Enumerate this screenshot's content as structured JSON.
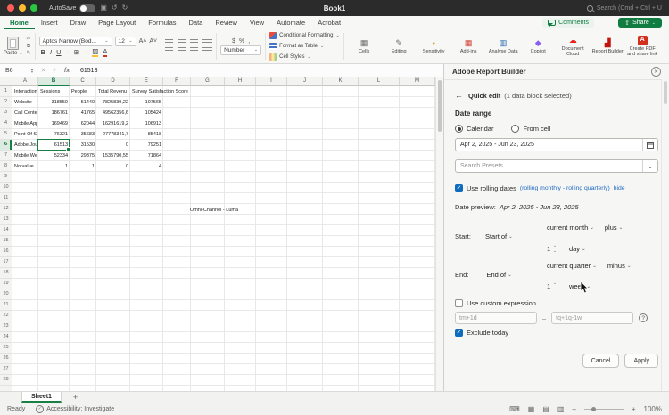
{
  "titlebar": {
    "autosave": "AutoSave",
    "title": "Book1",
    "search": "Search (Cmd + Ctrl + U"
  },
  "ribbon": {
    "tabs": [
      {
        "label": "Home",
        "active": true
      },
      {
        "label": "Insert"
      },
      {
        "label": "Draw"
      },
      {
        "label": "Page Layout"
      },
      {
        "label": "Formulas"
      },
      {
        "label": "Data"
      },
      {
        "label": "Review"
      },
      {
        "label": "View"
      },
      {
        "label": "Automate"
      },
      {
        "label": "Acrobat"
      }
    ],
    "comments": "Comments",
    "share": "Share",
    "paste": "Paste",
    "font_name": "Aptos Narrow (Bod...",
    "font_size": "12",
    "number_label": "Number",
    "styles": [
      "Conditional Formatting",
      "Format as Table",
      "Cell Styles"
    ],
    "big_buttons": [
      {
        "label": "Cells",
        "icon": "cells-icon"
      },
      {
        "label": "Editing",
        "icon": "editing-icon"
      },
      {
        "label": "Sensitivity",
        "icon": "sensitivity-icon"
      },
      {
        "label": "Add-ins",
        "icon": "add-ins-icon"
      },
      {
        "label": "Analyse Data",
        "icon": "analyse-data-icon"
      },
      {
        "label": "Copilot",
        "icon": "copilot-icon"
      },
      {
        "label": "Document Cloud",
        "icon": "document-cloud-icon"
      },
      {
        "label": "Report Builder",
        "icon": "report-builder-icon"
      },
      {
        "label": "Create PDF and share link",
        "icon": "create-pdf-icon"
      }
    ]
  },
  "formula_bar": {
    "name_box": "B6",
    "value": "61513"
  },
  "sheet": {
    "columns": [
      "A",
      "B",
      "C",
      "D",
      "E",
      "F",
      "G",
      "H",
      "I",
      "J",
      "K",
      "L",
      "M"
    ],
    "row_count": 28,
    "selected": {
      "col": "B",
      "row": 6
    },
    "rows": [
      [
        "Interaction C",
        "Sessions",
        "People",
        "Total Revenu",
        "Survey Satisfaction Score"
      ],
      [
        "Website",
        "318550",
        "51440",
        "7825839,22",
        "107565"
      ],
      [
        "Call Center",
        "186761",
        "41765",
        "49562356,6",
        "105424"
      ],
      [
        "Mobile App",
        "169469",
        "62044",
        "16291619,2",
        "106913"
      ],
      [
        "Point Of Sale",
        "76321",
        "35683",
        "27778341,7",
        "85418"
      ],
      [
        "Adobe Journe",
        "61513",
        "31530",
        "0",
        "79251"
      ],
      [
        "Mobile Web",
        "52334",
        "29375",
        "1535790,55",
        "71864"
      ],
      [
        "No value",
        "1",
        "1",
        "0",
        "4"
      ]
    ],
    "floating_text": "Omni-Channel - Luma",
    "tab": "Sheet1"
  },
  "status": {
    "ready": "Ready",
    "accessibility": "Accessibility: Investigate",
    "zoom": "100%"
  },
  "pane": {
    "title": "Adobe Report Builder",
    "quick_edit": "Quick edit",
    "selection_note": "(1 data block selected)",
    "section": "Date range",
    "radio_calendar": "Calendar",
    "radio_from_cell": "From cell",
    "date_value": "Apr 2, 2025 - Jun 23, 2025",
    "presets_placeholder": "Search Presets",
    "rolling_label": "Use rolling dates",
    "rolling_hint": "(rolling monthly - rolling quarterly)",
    "rolling_hide": "hide",
    "preview_label": "Date preview:",
    "preview_value": "Apr 2, 2025 - Jun 23, 2025",
    "start_label": "Start:",
    "start_of": "Start of",
    "start_unit": "current month",
    "start_op": "plus",
    "start_amount": "1",
    "start_gran": "day",
    "end_label": "End:",
    "end_of": "End of",
    "end_unit": "current quarter",
    "end_op": "minus",
    "end_amount": "1",
    "end_gran": "week",
    "custom_label": "Use custom expression",
    "custom_start": "tm+1d",
    "custom_end": "tq+1q-1w",
    "exclude_label": "Exclude today",
    "cancel": "Cancel",
    "apply": "Apply"
  }
}
